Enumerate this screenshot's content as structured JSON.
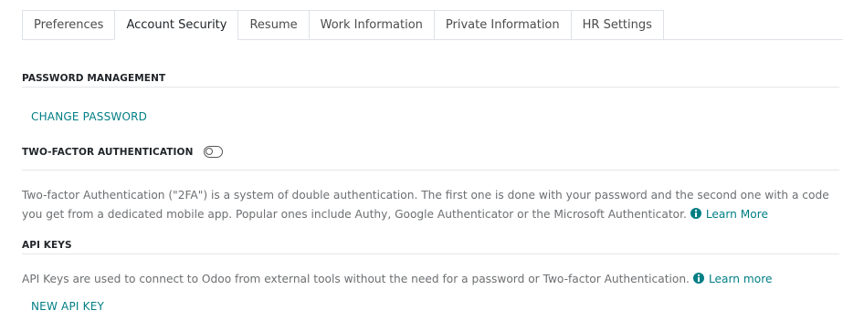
{
  "tabs": [
    {
      "label": "Preferences",
      "active": false
    },
    {
      "label": "Account Security",
      "active": true
    },
    {
      "label": "Resume",
      "active": false
    },
    {
      "label": "Work Information",
      "active": false
    },
    {
      "label": "Private Information",
      "active": false
    },
    {
      "label": "HR Settings",
      "active": false
    }
  ],
  "password": {
    "heading": "PASSWORD MANAGEMENT",
    "change_label": "CHANGE PASSWORD"
  },
  "twofa": {
    "heading": "TWO-FACTOR AUTHENTICATION",
    "enabled": false,
    "description": "Two-factor Authentication (\"2FA\") is a system of double authentication. The first one is done with your password and the second one with a code you get from a dedicated mobile app. Popular ones include Authy, Google Authenticator or the Microsoft Authenticator.",
    "learn_more": "Learn More"
  },
  "api_keys": {
    "heading": "API KEYS",
    "description": "API Keys are used to connect to Odoo from external tools without the need for a password or Two-factor Authentication.",
    "learn_more": "Learn more",
    "new_label": "NEW API KEY"
  },
  "colors": {
    "accent": "#017e84",
    "heading": "#212529",
    "body_text": "#6c6f72",
    "border": "#dee2e6"
  },
  "icons": {
    "info": "info-circle-icon",
    "toggle": "toggle-off-icon"
  }
}
